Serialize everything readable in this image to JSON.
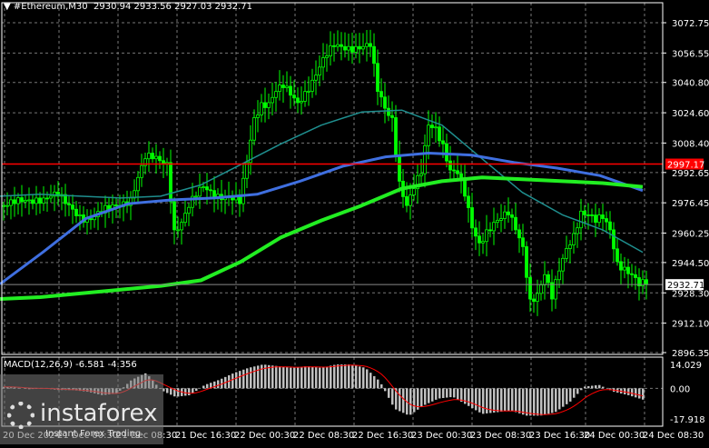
{
  "header": {
    "symbol": "#Ethereum,M30",
    "open": "2930.94",
    "high": "2933.56",
    "low": "2927.03",
    "close": "2932.71"
  },
  "macd_label": "MACD(12,26,9) -6.581 -4.356",
  "watermark": {
    "brand": "instaforex",
    "tagline": "Instant Forex Trading"
  },
  "colors": {
    "bull": "#00ff00",
    "bear": "#00ff00",
    "ma_fast": "#1f8f8f",
    "ma_mid": "#3f6fe0",
    "ma_slow": "#22ee22",
    "ask_line": "#ff0000",
    "hist": "#c0c0c0",
    "signal": "#ff0000"
  },
  "chart_data": {
    "type": "candlestick",
    "title": "#Ethereum,M30",
    "ylim": [
      2896.35,
      3072.75
    ],
    "y_ticks": [
      "3072.75",
      "3056.55",
      "3040.80",
      "3024.60",
      "3008.40",
      "2992.65",
      "2976.45",
      "2960.25",
      "2944.50",
      "2928.30",
      "2912.10",
      "2896.35"
    ],
    "x_ticks": [
      "20 Dec 2024",
      "21 Dec 00:30",
      "21 Dec 08:30",
      "21 Dec 16:30",
      "22 Dec 00:30",
      "22 Dec 08:30",
      "22 Dec 16:30",
      "23 Dec 00:30",
      "23 Dec 08:30",
      "23 Dec 16:30",
      "24 Dec 00:30",
      "24 Dec 08:30"
    ],
    "hline_red": {
      "value": 2997.17,
      "label": "2997.17"
    },
    "current_price": {
      "value": 2932.71,
      "label": "2932.71"
    },
    "hourly_closes": [
      2975,
      2976,
      2977,
      2978,
      2979,
      2979,
      2980,
      2980,
      2976,
      2973,
      2970,
      2968,
      2969,
      2971,
      2973,
      2975,
      2977,
      2979,
      2990,
      3000,
      3000,
      2999,
      2998,
      2962,
      2966,
      2974,
      2980,
      2985,
      2983,
      2981,
      2980,
      2978,
      2976,
      2998,
      3022,
      3030,
      3030,
      3036,
      3038,
      3034,
      3030,
      3036,
      3042,
      3049,
      3055,
      3060,
      3060,
      3060,
      3060,
      3060,
      3060,
      3036,
      3027,
      3022,
      2988,
      2975,
      2984,
      2992,
      3018,
      3017,
      3008,
      2994,
      2992,
      2980,
      2963,
      2955,
      2962,
      2966,
      2968,
      2970,
      2962,
      2953,
      2925,
      2928,
      2938,
      2925,
      2940,
      2952,
      2960,
      2972,
      2970,
      2966,
      2968,
      2962,
      2945,
      2942,
      2938,
      2932,
      2932.71
    ],
    "ma_fast": [
      2980,
      2981,
      2980,
      2979,
      2980,
      2986,
      2997,
      3008,
      3018,
      3025,
      3026,
      3018,
      3000,
      2982,
      2970,
      2962,
      2950
    ],
    "ma_mid": [
      2933,
      2950,
      2968,
      2976,
      2978,
      2979,
      2981,
      2988,
      2996,
      3001,
      3003,
      3002,
      2998,
      2995,
      2991,
      2983
    ],
    "ma_slow": [
      2925,
      2926,
      2928,
      2930,
      2932,
      2935,
      2945,
      2958,
      2967,
      2975,
      2984,
      2988,
      2990,
      2989,
      2988,
      2987,
      2985
    ],
    "macd": {
      "ylim": [
        -17.918,
        14.029
      ],
      "y_ticks": [
        "14.029",
        "0.00",
        "-17.918"
      ],
      "main": -6.581,
      "signal": -4.356,
      "histogram": [
        1,
        0.5,
        -0.5,
        0,
        -1,
        -1,
        -2,
        -4,
        -3,
        5,
        9,
        -1,
        -5,
        -4,
        2,
        5,
        9,
        12,
        14,
        13,
        12,
        13,
        12,
        14,
        14,
        12,
        4,
        -12,
        -16,
        -10,
        -6,
        -5,
        -10,
        -15,
        -14,
        -13,
        -16,
        -16,
        -14,
        -8,
        1,
        2,
        -2,
        -4,
        -6.6
      ]
    }
  }
}
